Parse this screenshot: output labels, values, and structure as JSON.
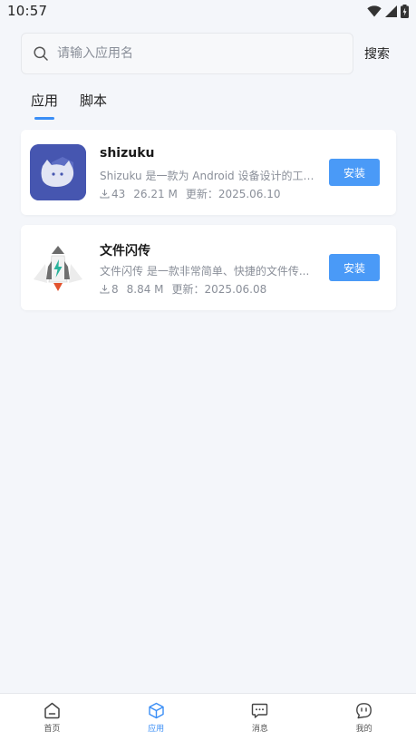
{
  "status_bar": {
    "time": "10:57"
  },
  "search": {
    "placeholder": "请输入应用名",
    "button_label": "搜索"
  },
  "tabs": [
    {
      "label": "应用",
      "active": true
    },
    {
      "label": "脚本",
      "active": false
    }
  ],
  "apps": [
    {
      "name": "shizuku",
      "description": "Shizuku 是一款为 Android 设备设计的工具...",
      "downloads": "43",
      "size": "26.21 M",
      "updated": "更新：2025.06.10",
      "install_label": "安装",
      "icon": "shizuku-cat-icon"
    },
    {
      "name": "文件闪传",
      "description": "文件闪传 是一款非常简单、快捷的文件传...",
      "downloads": "8",
      "size": "8.84 M",
      "updated": "更新：2025.06.08",
      "install_label": "安装",
      "icon": "rocket-icon"
    }
  ],
  "bottom_nav": [
    {
      "label": "首页",
      "icon": "home-icon",
      "active": false
    },
    {
      "label": "应用",
      "icon": "cube-icon",
      "active": true
    },
    {
      "label": "消息",
      "icon": "message-icon",
      "active": false
    },
    {
      "label": "我的",
      "icon": "profile-icon",
      "active": false
    }
  ],
  "colors": {
    "accent": "#3a8ef6",
    "install_button": "#4a9af7",
    "background": "#f4f6fa"
  }
}
